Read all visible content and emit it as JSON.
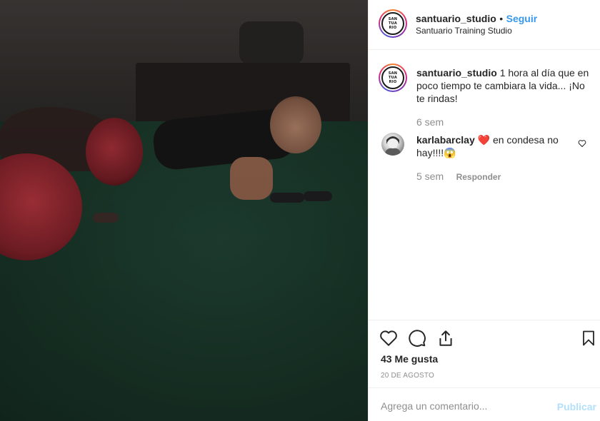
{
  "post": {
    "image_alt": "Workout photo: people doing plank exercises with medicine balls on green turf"
  },
  "header": {
    "avatar_logo_lines": [
      "SAN",
      "TUA",
      "RIO"
    ],
    "username": "santuario_studio",
    "separator": "•",
    "follow_label": "Seguir",
    "location": "Santuario Training Studio"
  },
  "caption": {
    "username": "santuario_studio",
    "text": "1 hora al día que en poco tiempo te cambiara la vida... ¡No te rindas!",
    "time": "6 sem"
  },
  "comments": [
    {
      "username": "karlabarclay",
      "emoji_heart": "❤️",
      "text": "en condesa no hay!!!!",
      "emoji_face": "😱",
      "time": "5 sem",
      "reply_label": "Responder"
    }
  ],
  "actions": {
    "likes_text": "43 Me gusta",
    "date": "20 DE AGOSTO"
  },
  "add_comment": {
    "placeholder": "Agrega un comentario...",
    "publish_label": "Publicar"
  },
  "colors": {
    "accent": "#3897f0",
    "muted": "#8e8e8e",
    "text": "#262626",
    "publish_disabled": "#b2dffc",
    "heart": "#ed4956"
  },
  "icons": [
    "heart-icon",
    "comment-icon",
    "share-icon",
    "bookmark-icon",
    "small-heart-icon"
  ]
}
